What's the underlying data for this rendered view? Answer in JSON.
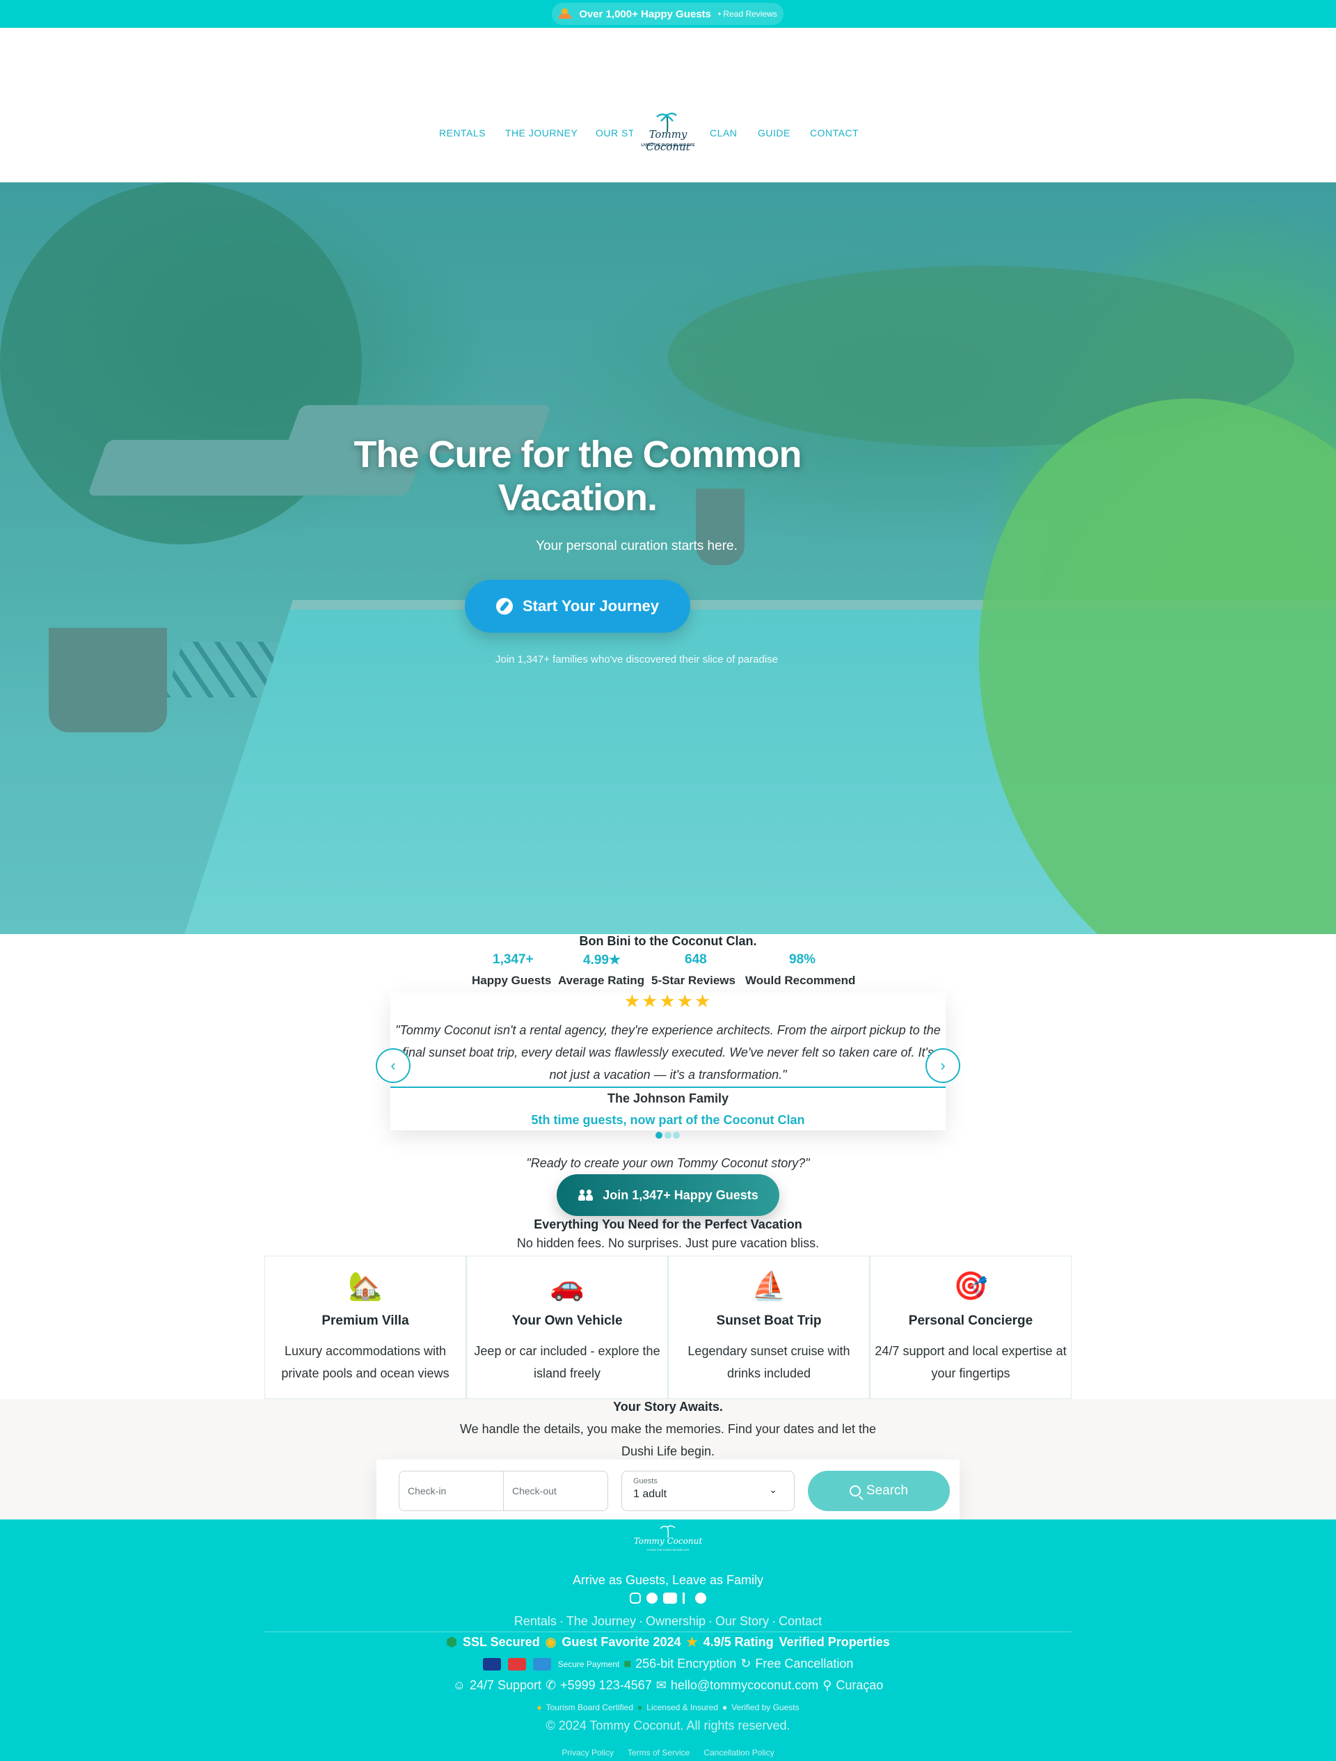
{
  "topbar": {
    "headline": "Over 1,000+ Happy Guests",
    "link": "• Read Reviews"
  },
  "nav": {
    "items": [
      "RENTALS",
      "THE JOURNEY",
      "OUR STORY",
      "CLAN",
      "GUIDE",
      "CONTACT"
    ],
    "logo_text": "Tommy Coconut",
    "logo_tagline": "LIVING THE DUSHI ISLAND LIFE"
  },
  "hero": {
    "title": "The Cure for the Common Vacation.",
    "subtitle": "Your personal curation starts here.",
    "cta": "Start Your Journey",
    "note": "Join 1,347+ families who've discovered their slice of paradise"
  },
  "welcome": "Bon Bini to the Coconut Clan.",
  "stats": [
    {
      "value": "1,347+",
      "label": "Happy Guests"
    },
    {
      "value": "4.99★",
      "label": "Average Rating"
    },
    {
      "value": "648",
      "label": "5-Star Reviews"
    },
    {
      "value": "98%",
      "label": "Would Recommend"
    }
  ],
  "testimonial": {
    "stars": "★★★★★",
    "quote": "\"Tommy Coconut isn't a rental agency, they're experience architects. From the airport pickup to the final sunset boat trip, every detail was flawlessly executed. We've never felt so taken care of. It's not just a vacation — it's a transformation.\"",
    "name": "The Johnson Family",
    "role": "5th time guests, now part of the Coconut Clan",
    "prev": "‹",
    "next": "›",
    "active_slide": 1,
    "total_slides": 3
  },
  "ready_text": "\"Ready to create your own Tommy Coconut story?\"",
  "join_cta": "Join 1,347+ Happy Guests",
  "features": {
    "title": "Everything You Need for the Perfect Vacation",
    "subtitle": "No hidden fees. No surprises. Just pure vacation bliss.",
    "items": [
      {
        "icon": "house-tree-icon",
        "emoji": "🏡",
        "title": "Premium Villa",
        "desc": "Luxury accommodations with private pools and ocean views"
      },
      {
        "icon": "car-icon",
        "emoji": "🚗",
        "title": "Your Own Vehicle",
        "desc": "Jeep or car included - explore the island freely"
      },
      {
        "icon": "sailboat-icon",
        "emoji": "⛵",
        "title": "Sunset Boat Trip",
        "desc": "Legendary sunset cruise with drinks included"
      },
      {
        "icon": "target-icon",
        "emoji": "🎯",
        "title": "Personal Concierge",
        "desc": "24/7 support and local expertise at your fingertips"
      }
    ]
  },
  "booking": {
    "title": "Your Story Awaits.",
    "subtitle": "We handle the details, you make the memories. Find your dates and let the Dushi Life begin.",
    "checkin_placeholder": "Check-in",
    "checkout_placeholder": "Check-out",
    "guests_label": "Guests",
    "guests_value": "1 adult",
    "search": "Search"
  },
  "footer": {
    "tagline": "Arrive as Guests, Leave as Family",
    "social": [
      "instagram-icon",
      "facebook-icon",
      "youtube-icon",
      "tiktok-icon",
      "spotify-icon"
    ],
    "links": [
      "Rentals",
      "The Journey",
      "Ownership",
      "Our Story",
      "Contact"
    ],
    "separator": "·",
    "badges": [
      "SSL Secured",
      "Guest Favorite 2024",
      "4.9/5 Rating",
      "Verified Properties"
    ],
    "payment_label": "Secure Payment",
    "encryption": "256-bit Encryption",
    "cancellation": "Free Cancellation",
    "support": "24/7 Support",
    "phone": "+5999 123-4567",
    "email": "hello@tommycoconut.com",
    "location": "Curaçao",
    "certs": [
      "Tourism Board Certified",
      "Licensed & Insured",
      "Verified by Guests"
    ],
    "copyright": "© 2024 Tommy Coconut. All rights reserved.",
    "legal": [
      "Privacy Policy",
      "Terms of Service",
      "Cancellation Policy"
    ]
  },
  "colors": {
    "brand": "#00cfcf",
    "accent": "#19b3c8",
    "cta_blue": "#1aa2e0",
    "star": "#ffc21a"
  }
}
